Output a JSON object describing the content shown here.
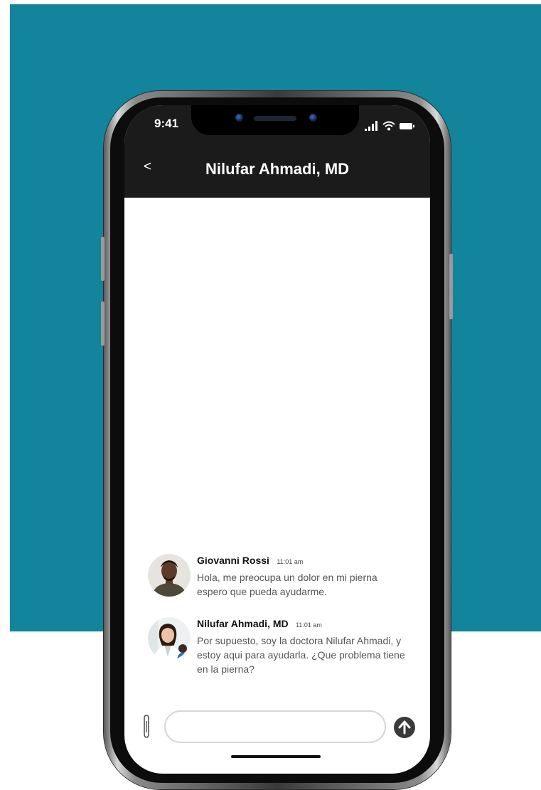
{
  "status_bar": {
    "time": "9:41"
  },
  "header": {
    "back_label": "<",
    "title": "Nilufar Ahmadi, MD"
  },
  "messages": [
    {
      "sender": "Giovanni Rossi",
      "time": "11:01 am",
      "text": "Hola, me preocupa un dolor en mi pierna espero que pueda ayudarme.",
      "avatar_icon": "man-avatar"
    },
    {
      "sender": "Nilufar Ahmadi, MD",
      "time": "11:01 am",
      "text": "Por supuesto, soy la doctora Nilufar Ahmadi, y estoy aqui para ayudarla. ¿Que problema tiene en la pierna?",
      "avatar_icon": "doctor-avatar"
    }
  ],
  "composer": {
    "placeholder": "",
    "value": "",
    "attach_icon": "paperclip-icon",
    "send_icon": "arrow-up-icon"
  },
  "colors": {
    "background_teal": "#12849c",
    "header_bar": "#1b1b1b",
    "send_button": "#3a3a3a"
  }
}
